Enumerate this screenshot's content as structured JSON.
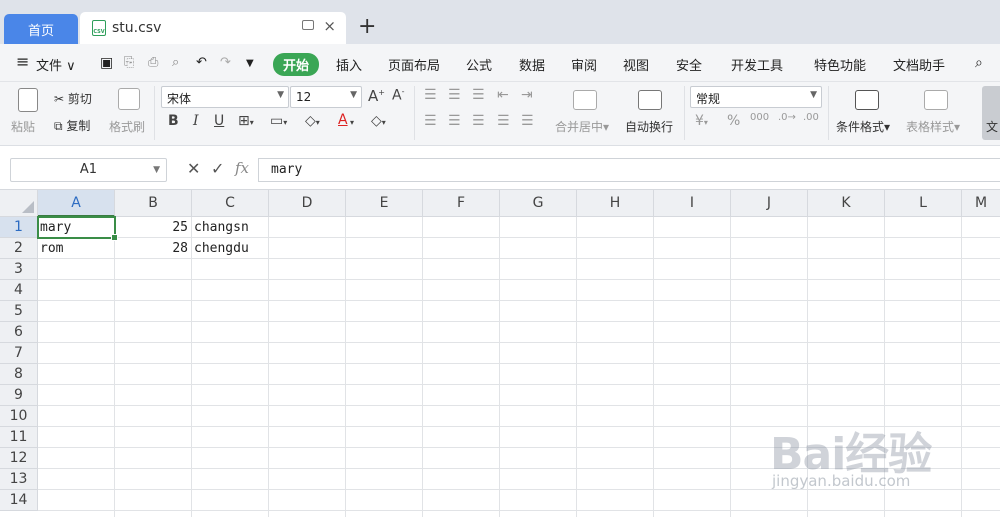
{
  "tabs": {
    "home_label": "首页",
    "file_label": "stu.csv",
    "file_icon_text": "CSV",
    "close_glyph": "×",
    "add_glyph": "+"
  },
  "menu": {
    "file_label": "文件",
    "items": [
      "开始",
      "插入",
      "页面布局",
      "公式",
      "数据",
      "审阅",
      "视图",
      "安全",
      "开发工具",
      "特色功能",
      "文档助手"
    ],
    "active_index": 0,
    "accent_color": "#3aa655"
  },
  "ribbon": {
    "paste_label": "粘贴",
    "cut_label": "剪切",
    "copy_label": "复制",
    "format_painter_label": "格式刷",
    "font_name": "宋体",
    "font_size": "12",
    "bold": "B",
    "italic": "I",
    "underline": "U",
    "font_color_glyph": "A",
    "merge_center_label": "合并居中",
    "wrap_text_label": "自动换行",
    "number_format": "常规",
    "conditional_format_label": "条件格式",
    "table_style_label": "表格样式",
    "cut_off_label": "文"
  },
  "formula_bar": {
    "name_box": "A1",
    "fx_label": "fx",
    "value": "mary"
  },
  "sheet": {
    "columns": [
      "A",
      "B",
      "C",
      "D",
      "E",
      "F",
      "G",
      "H",
      "I",
      "J",
      "K",
      "L",
      "M"
    ],
    "rows": [
      "1",
      "2",
      "3",
      "4",
      "5",
      "6",
      "7",
      "8",
      "9",
      "10",
      "11",
      "12",
      "13",
      "14"
    ],
    "selected_cell": "A1",
    "data": [
      [
        "mary",
        "25",
        "changsn"
      ],
      [
        "rom",
        "28",
        "chengdu"
      ]
    ]
  },
  "watermark": {
    "logo_text": "Bai经验",
    "url_text": "jingyan.baidu.com"
  }
}
